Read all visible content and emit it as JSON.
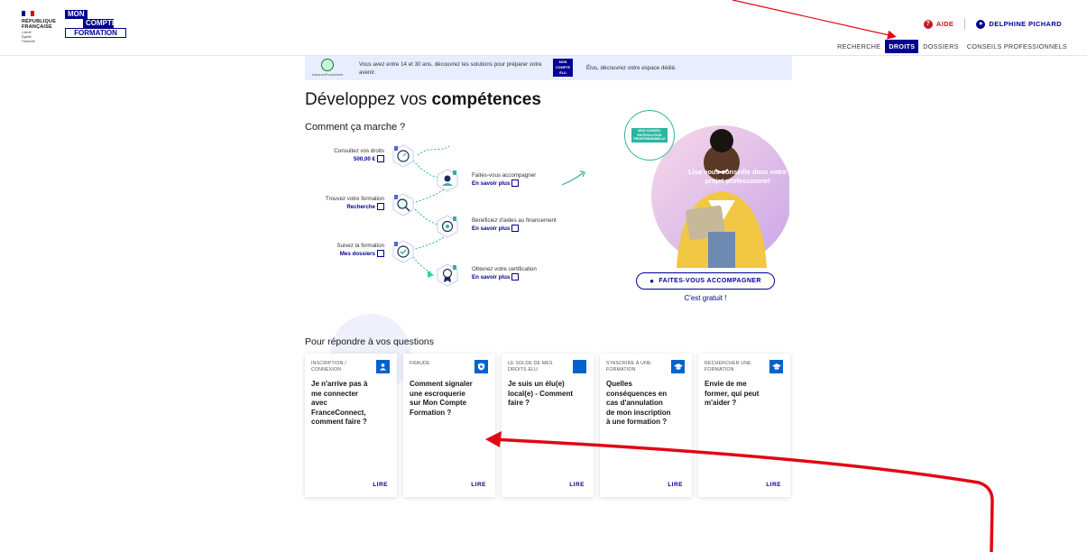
{
  "header": {
    "republic_lines": [
      "RÉPUBLIQUE",
      "FRANÇAISE"
    ],
    "republic_motto": [
      "Liberté",
      "Égalité",
      "Fraternité"
    ],
    "app_logo_lines": [
      "MON",
      "COMPTE",
      "FORMATION"
    ],
    "help_label": "AIDE",
    "user_name": "DELPHINE PICHARD",
    "nav": [
      {
        "label": "RECHERCHE",
        "active": false
      },
      {
        "label": "DROITS",
        "active": true
      },
      {
        "label": "DOSSIERS",
        "active": false
      },
      {
        "label": "CONSEILS PROFESSIONNELS",
        "active": false
      }
    ]
  },
  "banner": {
    "hashtag": "#JeunesPourAvenir",
    "text_youth": "Vous avez entre 14 et 30 ans, découvrez les solutions pour préparer votre avenir.",
    "elu_logo": [
      "MON",
      "COMPTE",
      "ÉLU"
    ],
    "text_elu": "Élus, découvrez votre espace dédié."
  },
  "main": {
    "title_regular": "Développez vos ",
    "title_bold": "compétences",
    "how_it_works": "Comment ça marche ?",
    "steps": [
      {
        "label": "Consultez vos droits",
        "link": "500,00 €"
      },
      {
        "label": "Faites-vous accompagner",
        "link": "En savoir plus"
      },
      {
        "label": "Trouvez votre formation",
        "link": "Recherche"
      },
      {
        "label": "Bénéficiez d'aides au financement",
        "link": "En savoir plus"
      },
      {
        "label": "Suivez la formation",
        "link": "Mes dossiers"
      },
      {
        "label": "Obtenez votre certification",
        "link": "En savoir plus"
      }
    ],
    "hero": {
      "badge": [
        "MON CONSEIL",
        "EN ÉVOLUTION",
        "PROFESSIONNELLE"
      ],
      "caption": "Lisa vous conseille dans votre projet professionnel"
    },
    "cta_label": "FAITES-VOUS ACCOMPAGNER",
    "cta_note": "C'est gratuit !"
  },
  "questions": {
    "title": "Pour répondre à vos questions",
    "cards": [
      {
        "category": "INSCRIPTION / CONNEXION",
        "question": "Je n'arrive pas à me connecter avec FranceConnect, comment faire ?",
        "icon": "user-icon",
        "action": "LIRE"
      },
      {
        "category": "FRAUDE",
        "question": "Comment signaler une escroquerie sur Mon Compte Formation ?",
        "icon": "shield-icon",
        "action": "LIRE"
      },
      {
        "category": "LE SOLDE DE MES DROITS ELU",
        "question": "Je suis un élu(e) local(e) - Comment faire ?",
        "icon": "blank-icon",
        "action": "LIRE"
      },
      {
        "category": "S'INSCRIRE À UNE FORMATION",
        "question": "Quelles conséquences en cas d'annulation de mon inscription à une formation ?",
        "icon": "graduation-cap-icon",
        "action": "LIRE"
      },
      {
        "category": "RECHERCHER UNE FORMATION",
        "question": "Envie de me former, qui peut m'aider ?",
        "icon": "graduation-cap-icon",
        "action": "LIRE"
      }
    ]
  },
  "colors": {
    "primary": "#000091",
    "accent_red": "#c9191e",
    "card_icon": "#0063cb",
    "annotation": "#e30613"
  }
}
